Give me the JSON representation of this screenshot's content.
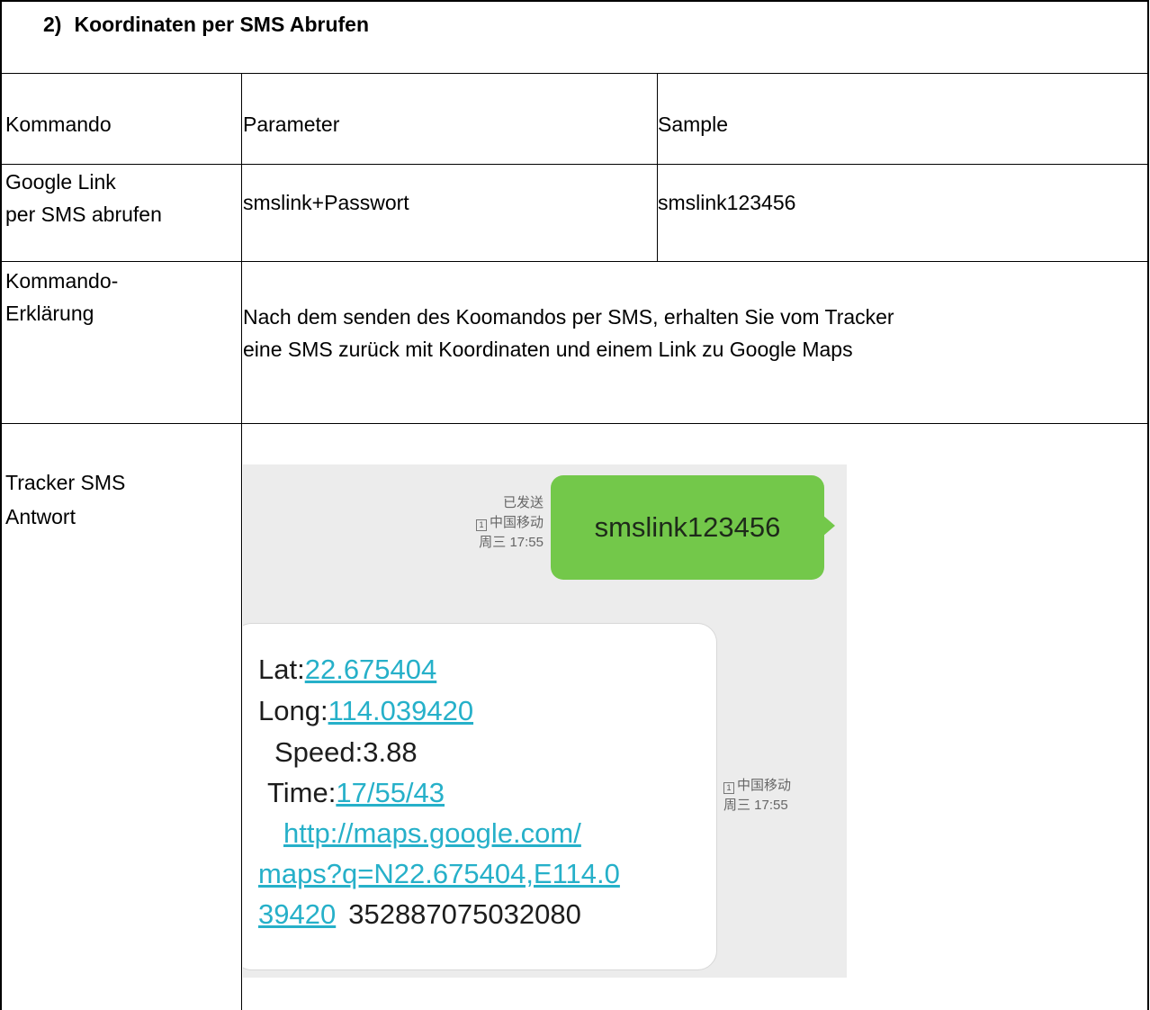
{
  "heading": {
    "number": "2)",
    "text": "Koordinaten per SMS Abrufen"
  },
  "table": {
    "headers": [
      "Kommando",
      "Parameter",
      "Sample"
    ],
    "row_google": {
      "label_line1": "Google Link",
      "label_line2": "per SMS abrufen",
      "parameter": "smslink+Passwort",
      "sample": "smslink123456"
    },
    "row_explain": {
      "label_line1": "Kommando-",
      "label_line2": "Erklärung",
      "text_line1": "Nach dem senden des Koomandos  per SMS, erhalten Sie vom Tracker",
      "text_line2": "eine SMS zurück mit Koordinaten und einem Link zu Google Maps"
    },
    "row_reply": {
      "label_line1": "Tracker SMS",
      "label_line2": "Antwort"
    }
  },
  "sms": {
    "sent": {
      "status": "已发送",
      "sim": "1",
      "carrier": "中国移动",
      "time": "周三 17:55",
      "text": "smslink123456"
    },
    "received": {
      "lat_label": "Lat:",
      "lat_value": "22.675404",
      "long_label": "Long:",
      "long_value": "114.039420",
      "speed": "Speed:3.88",
      "time_label": "Time:",
      "time_value": "17/55/43",
      "url_line1": "http://maps.google.com/",
      "url_line2": "maps?q=N22.675404,E114.0",
      "url_line3": "39420",
      "imei": "352887075032080",
      "sim": "1",
      "carrier": "中国移动",
      "time": "周三 17:55"
    },
    "colors": {
      "sent_bubble": "#73c84a",
      "link": "#26b0c9",
      "background": "#ececec"
    }
  }
}
